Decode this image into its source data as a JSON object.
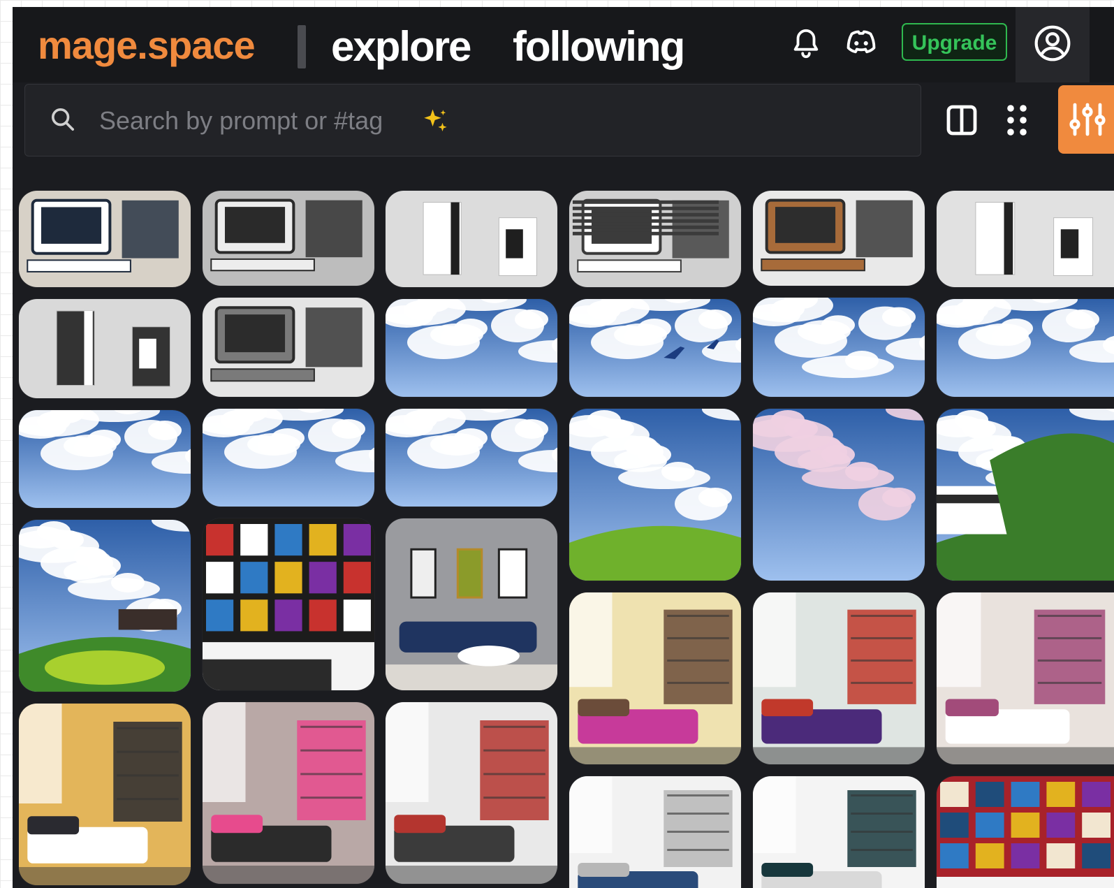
{
  "brand": "mage.space",
  "nav": {
    "explore": "explore",
    "following": "following"
  },
  "header": {
    "upgrade_label": "Upgrade"
  },
  "search": {
    "placeholder": "Search by prompt or #tag",
    "sparkle": "✨"
  },
  "icons": {
    "bell": "bell-icon",
    "discord": "discord-icon",
    "profile": "user-circle-icon",
    "search": "search-icon",
    "layout": "split-view-icon",
    "grid": "grid-dots-icon",
    "filter": "sliders-icon"
  },
  "colors": {
    "accent": "#f08a3e",
    "upgrade_green": "#35c45a",
    "background": "#1b1c20",
    "header": "#17181b"
  },
  "gallery": {
    "columns": [
      {
        "tiles": [
          {
            "subject": "retro-computer",
            "palette": [
              "#d7d1c7",
              "#1e2a3c",
              "#ffffff"
            ]
          },
          {
            "subject": "pc-tower",
            "palette": [
              "#d9d9d9",
              "#ffffff",
              "#333333"
            ]
          },
          {
            "subject": "sky-clouds",
            "palette": [
              "#2e5fa8",
              "#ffffff",
              "#556b3a"
            ]
          },
          {
            "subject": "garden-pagoda",
            "palette": [
              "#2d63c9",
              "#3f8a2a",
              "#a8d02e"
            ]
          },
          {
            "subject": "bedroom",
            "palette": [
              "#e3b55a",
              "#2a2a30",
              "#ffffff"
            ]
          }
        ]
      },
      {
        "tiles": [
          {
            "subject": "retro-computer",
            "palette": [
              "#bdbdbd",
              "#2a2a2a",
              "#ededed"
            ]
          },
          {
            "subject": "pc-monitor",
            "palette": [
              "#e5e5e5",
              "#2c2c2c",
              "#7a7a7a"
            ]
          },
          {
            "subject": "sky-clouds",
            "palette": [
              "#1b2aa8",
              "#e7c6ee",
              "#ffffff"
            ]
          },
          {
            "subject": "poster-wall",
            "palette": [
              "#1c1c1c",
              "#c8322e",
              "#ffffff"
            ]
          },
          {
            "subject": "bedroom",
            "palette": [
              "#b9a8a6",
              "#e74b8d",
              "#2b2b2b"
            ]
          }
        ]
      },
      {
        "tiles": [
          {
            "subject": "pc-tower",
            "palette": [
              "#dcdcdc",
              "#1f1f1f",
              "#ffffff"
            ]
          },
          {
            "subject": "sky-clouds",
            "palette": [
              "#2d5cb5",
              "#ffffff",
              "#8fb1e2"
            ]
          },
          {
            "subject": "sky-clouds",
            "palette": [
              "#2a6bd6",
              "#ffffff",
              "#a8c7f0"
            ]
          },
          {
            "subject": "living-room",
            "palette": [
              "#9a9b9f",
              "#1f3460",
              "#ffffff"
            ]
          },
          {
            "subject": "bedroom",
            "palette": [
              "#e9e9e9",
              "#b4352f",
              "#3b3b3b"
            ]
          }
        ]
      },
      {
        "tiles": [
          {
            "subject": "keyboard",
            "palette": [
              "#d0d0d0",
              "#3b3b3b",
              "#ffffff"
            ]
          },
          {
            "subject": "sky-airplane",
            "palette": [
              "#2f5fbf",
              "#ffffff",
              "#1b3c80"
            ]
          },
          {
            "subject": "sky-hill",
            "palette": [
              "#1d3bd1",
              "#ffffff",
              "#6fb12c"
            ]
          },
          {
            "subject": "bedroom",
            "palette": [
              "#efe2b0",
              "#6b4c3a",
              "#c73a9a"
            ]
          },
          {
            "subject": "bedroom",
            "palette": [
              "#f2f2f2",
              "#b7b7b7",
              "#2a4b7a"
            ]
          }
        ]
      },
      {
        "tiles": [
          {
            "subject": "pc-monitor",
            "palette": [
              "#e9e9e9",
              "#2d2d2d",
              "#a76b3a"
            ]
          },
          {
            "subject": "sky-clouds",
            "palette": [
              "#2c55a8",
              "#ffffff",
              "#7fa1d8"
            ]
          },
          {
            "subject": "sunset-clouds",
            "palette": [
              "#1b3a9c",
              "#efd0e1",
              "#d9a534"
            ]
          },
          {
            "subject": "bedroom",
            "palette": [
              "#dfe5e2",
              "#c1392b",
              "#4b2a7a"
            ]
          },
          {
            "subject": "bedroom",
            "palette": [
              "#f4f4f4",
              "#17373c",
              "#d9d9d9"
            ]
          }
        ]
      },
      {
        "tiles": [
          {
            "subject": "pc-tower",
            "palette": [
              "#e1e1e1",
              "#222222",
              "#ffffff"
            ]
          },
          {
            "subject": "sky-clouds",
            "palette": [
              "#2a5fc0",
              "#ffffff",
              "#8fb0e6"
            ]
          },
          {
            "subject": "hill-building",
            "palette": [
              "#2b7de2",
              "#3a7d2a",
              "#ffffff"
            ]
          },
          {
            "subject": "bedroom",
            "palette": [
              "#e9e2dd",
              "#a24b7a",
              "#ffffff"
            ]
          },
          {
            "subject": "poster-wall",
            "palette": [
              "#a8222a",
              "#f2e6d0",
              "#1f4c7a"
            ]
          }
        ]
      }
    ]
  }
}
